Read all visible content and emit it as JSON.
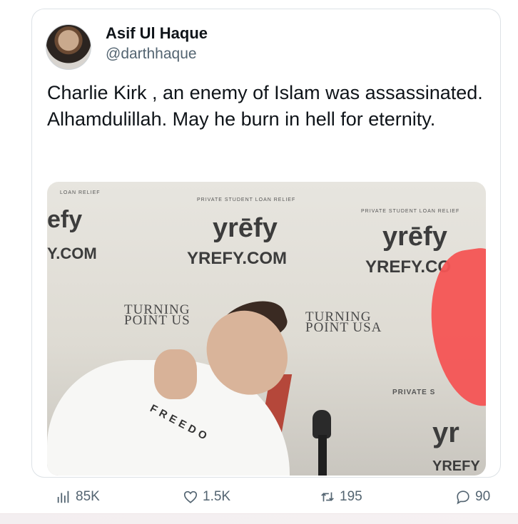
{
  "tweet": {
    "author_name": "Asif Ul Haque",
    "author_handle": "@darthhaque",
    "text": "Charlie Kirk , an enemy of Islam was assassinated. Alhamdulillah. May he burn in hell for eternity."
  },
  "media": {
    "sign_texts": {
      "yrefy_logo_1": "yrēfy",
      "yrefy_url_1": "YREFY.COM",
      "yrefy_logo_2": "yrēfy",
      "yrefy_url_2": "YREFY.CO",
      "partial_left_logo": "efy",
      "partial_left_url": "Y.COM",
      "partial_right_logo": "yr",
      "partial_right_url": "YREFY",
      "loan_relief_1": "PRIVATE STUDENT LOAN RELIEF",
      "loan_relief_2": "PRIVATE STUDENT LOAN RELIEF",
      "loan_relief_partial": "LOAN RELIEF",
      "private_partial": "PRIVATE S",
      "turning_point_1": "TURNING POINT US",
      "turning_point_2": "TURNING POINT USA",
      "shirt_text": "FREEDO"
    }
  },
  "actions": {
    "views": "85K",
    "likes": "1.5K",
    "reposts": "195",
    "replies": "90"
  },
  "icons": [
    "views-icon",
    "like-icon",
    "repost-icon",
    "reply-icon"
  ],
  "colors": {
    "text": "#0f1419",
    "muted": "#536471",
    "border": "#dde2e6"
  }
}
